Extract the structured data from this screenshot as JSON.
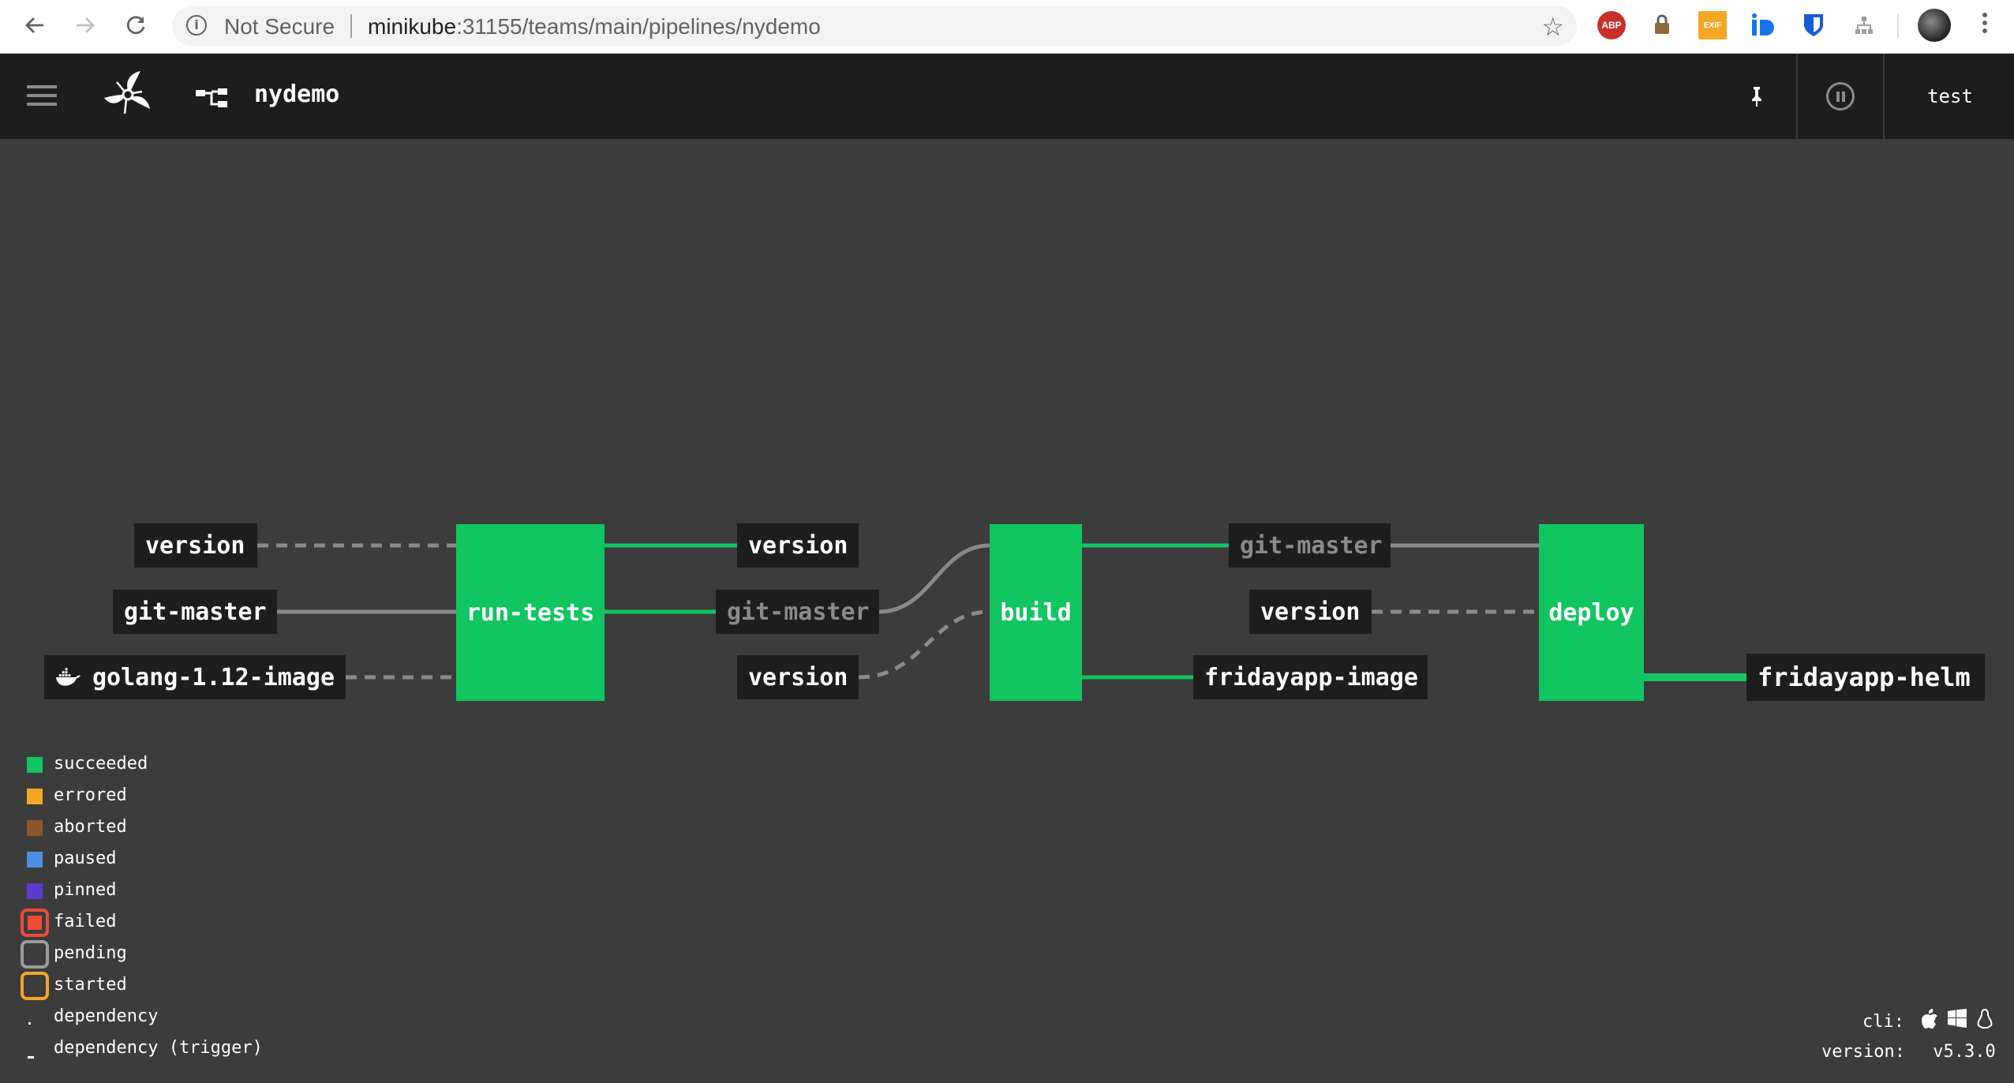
{
  "browser": {
    "security_label": "Not Secure",
    "url_host": "minikube",
    "url_rest": ":31155/teams/main/pipelines/nydemo",
    "extensions": [
      "ABP",
      "EXIF"
    ]
  },
  "header": {
    "pipeline_name": "nydemo",
    "user": "test"
  },
  "pipeline": {
    "jobs": [
      {
        "id": "run-tests",
        "label": "run-tests",
        "status": "succeeded"
      },
      {
        "id": "build",
        "label": "build",
        "status": "succeeded"
      },
      {
        "id": "deploy",
        "label": "deploy",
        "status": "succeeded"
      }
    ],
    "resources": [
      {
        "id": "in-version-1",
        "label": "version",
        "dim": false
      },
      {
        "id": "in-git-master-1",
        "label": "git-master",
        "dim": false
      },
      {
        "id": "in-golang-image",
        "label": "golang-1.12-image",
        "dim": false,
        "icon": "docker-icon"
      },
      {
        "id": "mid-version-1",
        "label": "version",
        "dim": false
      },
      {
        "id": "mid-git-master",
        "label": "git-master",
        "dim": true
      },
      {
        "id": "mid-version-2",
        "label": "version",
        "dim": false
      },
      {
        "id": "b-git-master",
        "label": "git-master",
        "dim": true
      },
      {
        "id": "b-version",
        "label": "version",
        "dim": false
      },
      {
        "id": "b-fridayapp-image",
        "label": "fridayapp-image",
        "dim": false
      },
      {
        "id": "out-fridayapp-helm",
        "label": "fridayapp-helm",
        "dim": false
      }
    ]
  },
  "legend": [
    {
      "label": "succeeded",
      "kind": "square",
      "color": "#11c560"
    },
    {
      "label": "errored",
      "kind": "square",
      "color": "#f5a623"
    },
    {
      "label": "aborted",
      "kind": "square",
      "color": "#8b572a"
    },
    {
      "label": "paused",
      "kind": "square",
      "color": "#4a90e2"
    },
    {
      "label": "pinned",
      "kind": "square",
      "color": "#5c3bd1"
    },
    {
      "label": "failed",
      "kind": "ring",
      "color": "#ed4b35",
      "ring": "#ed4b35"
    },
    {
      "label": "pending",
      "kind": "ring",
      "color": "#3d3c3c",
      "ring": "#9b9b9b"
    },
    {
      "label": "started",
      "kind": "ring",
      "color": "#3d3c3c",
      "ring": "#f5a623"
    },
    {
      "label": "dependency",
      "kind": "dot"
    },
    {
      "label": "dependency (trigger)",
      "kind": "dash"
    }
  ],
  "footer": {
    "cli_label": "cli:",
    "version_label": "version:",
    "version_value": "v5.3.0"
  },
  "colors": {
    "background": "#3d3c3c",
    "bar": "#1e1d1d",
    "succeeded": "#11c560",
    "edge_trigger": "#11c560",
    "edge_plain": "#8a8a8a"
  }
}
